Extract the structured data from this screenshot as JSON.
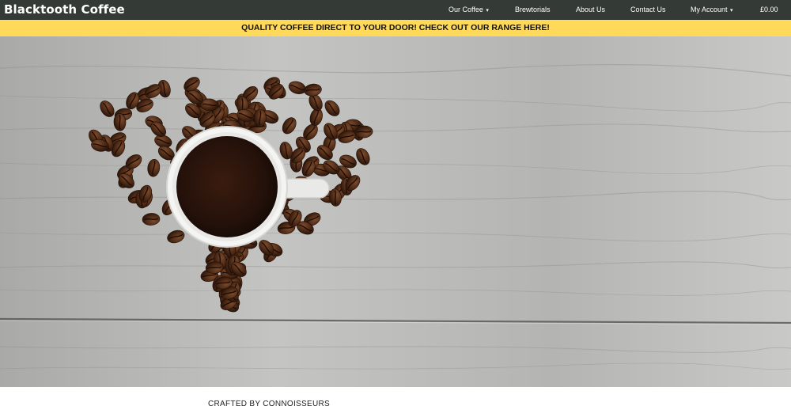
{
  "brand": "Blacktooth Coffee",
  "nav": {
    "our_coffee": "Our Coffee",
    "brewtorials": "Brewtorials",
    "about_us": "About Us",
    "contact_us": "Contact Us",
    "my_account": "My Account",
    "basket_total": "£0.00",
    "dropdown_caret": "▾"
  },
  "banner": {
    "text": "QUALITY COFFEE DIRECT TO YOUR DOOR! CHECK OUT OUR RANGE HERE!"
  },
  "hero": {
    "image_subject": "coffee cup on heart of coffee beans on wooden table"
  },
  "section": {
    "heading": "CRAFTED BY CONNOISSEURS"
  },
  "colors": {
    "navbar": "#343a35",
    "banner": "#fed95a",
    "wood": "#b9b9b7",
    "coffee": "#2a140b"
  }
}
